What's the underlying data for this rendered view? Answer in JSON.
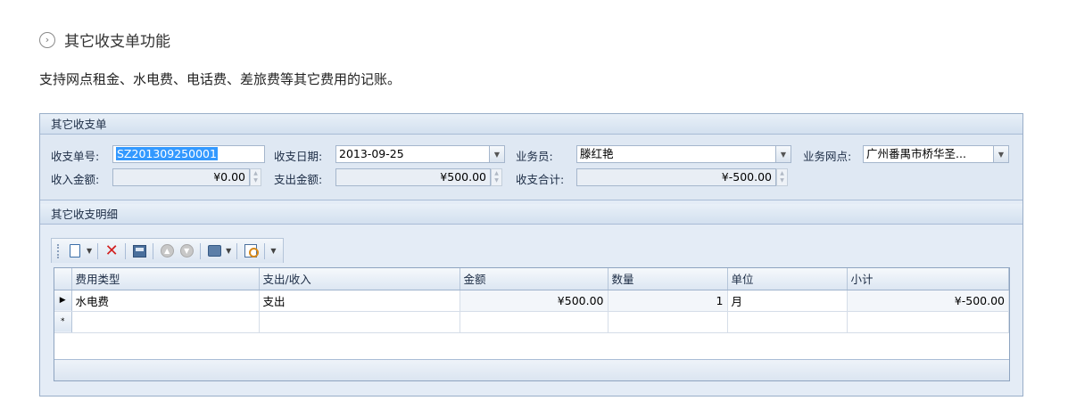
{
  "section": {
    "icon": "circle-chevron-right-icon",
    "title": "其它收支单功能"
  },
  "description": "支持网点租金、水电费、电话费、差旅费等其它费用的记账。",
  "window": {
    "panel_title": "其它收支单",
    "form": {
      "doc_no_label": "收支单号:",
      "doc_no_value": "SZ201309250001",
      "date_label": "收支日期:",
      "date_value": "2013-09-25",
      "staff_label": "业务员:",
      "staff_value": "滕红艳",
      "branch_label": "业务网点:",
      "branch_value": "广州番禺市桥华圣...",
      "income_label": "收入金额:",
      "income_value": "¥0.00",
      "expense_label": "支出金额:",
      "expense_value": "¥500.00",
      "total_label": "收支合计:",
      "total_value": "¥-500.00"
    },
    "detail_title": "其它收支明细",
    "toolbar": [
      "new-icon",
      "delete-icon",
      "save-icon",
      "move-up-icon",
      "move-down-icon",
      "print-icon",
      "find-icon"
    ],
    "grid": {
      "columns": [
        "费用类型",
        "支出/收入",
        "金额",
        "数量",
        "单位",
        "小计"
      ],
      "rows": [
        {
          "indicator": "▶",
          "type": "水电费",
          "direction": "支出",
          "amount": "¥500.00",
          "qty": "1",
          "unit": "月",
          "subtotal": "¥-500.00"
        }
      ],
      "new_row_indicator": "*"
    }
  },
  "colors": {
    "panel_bg": "#dfe8f3",
    "border": "#99aec8",
    "selection": "#3399ff",
    "delete": "#d21f1f"
  }
}
